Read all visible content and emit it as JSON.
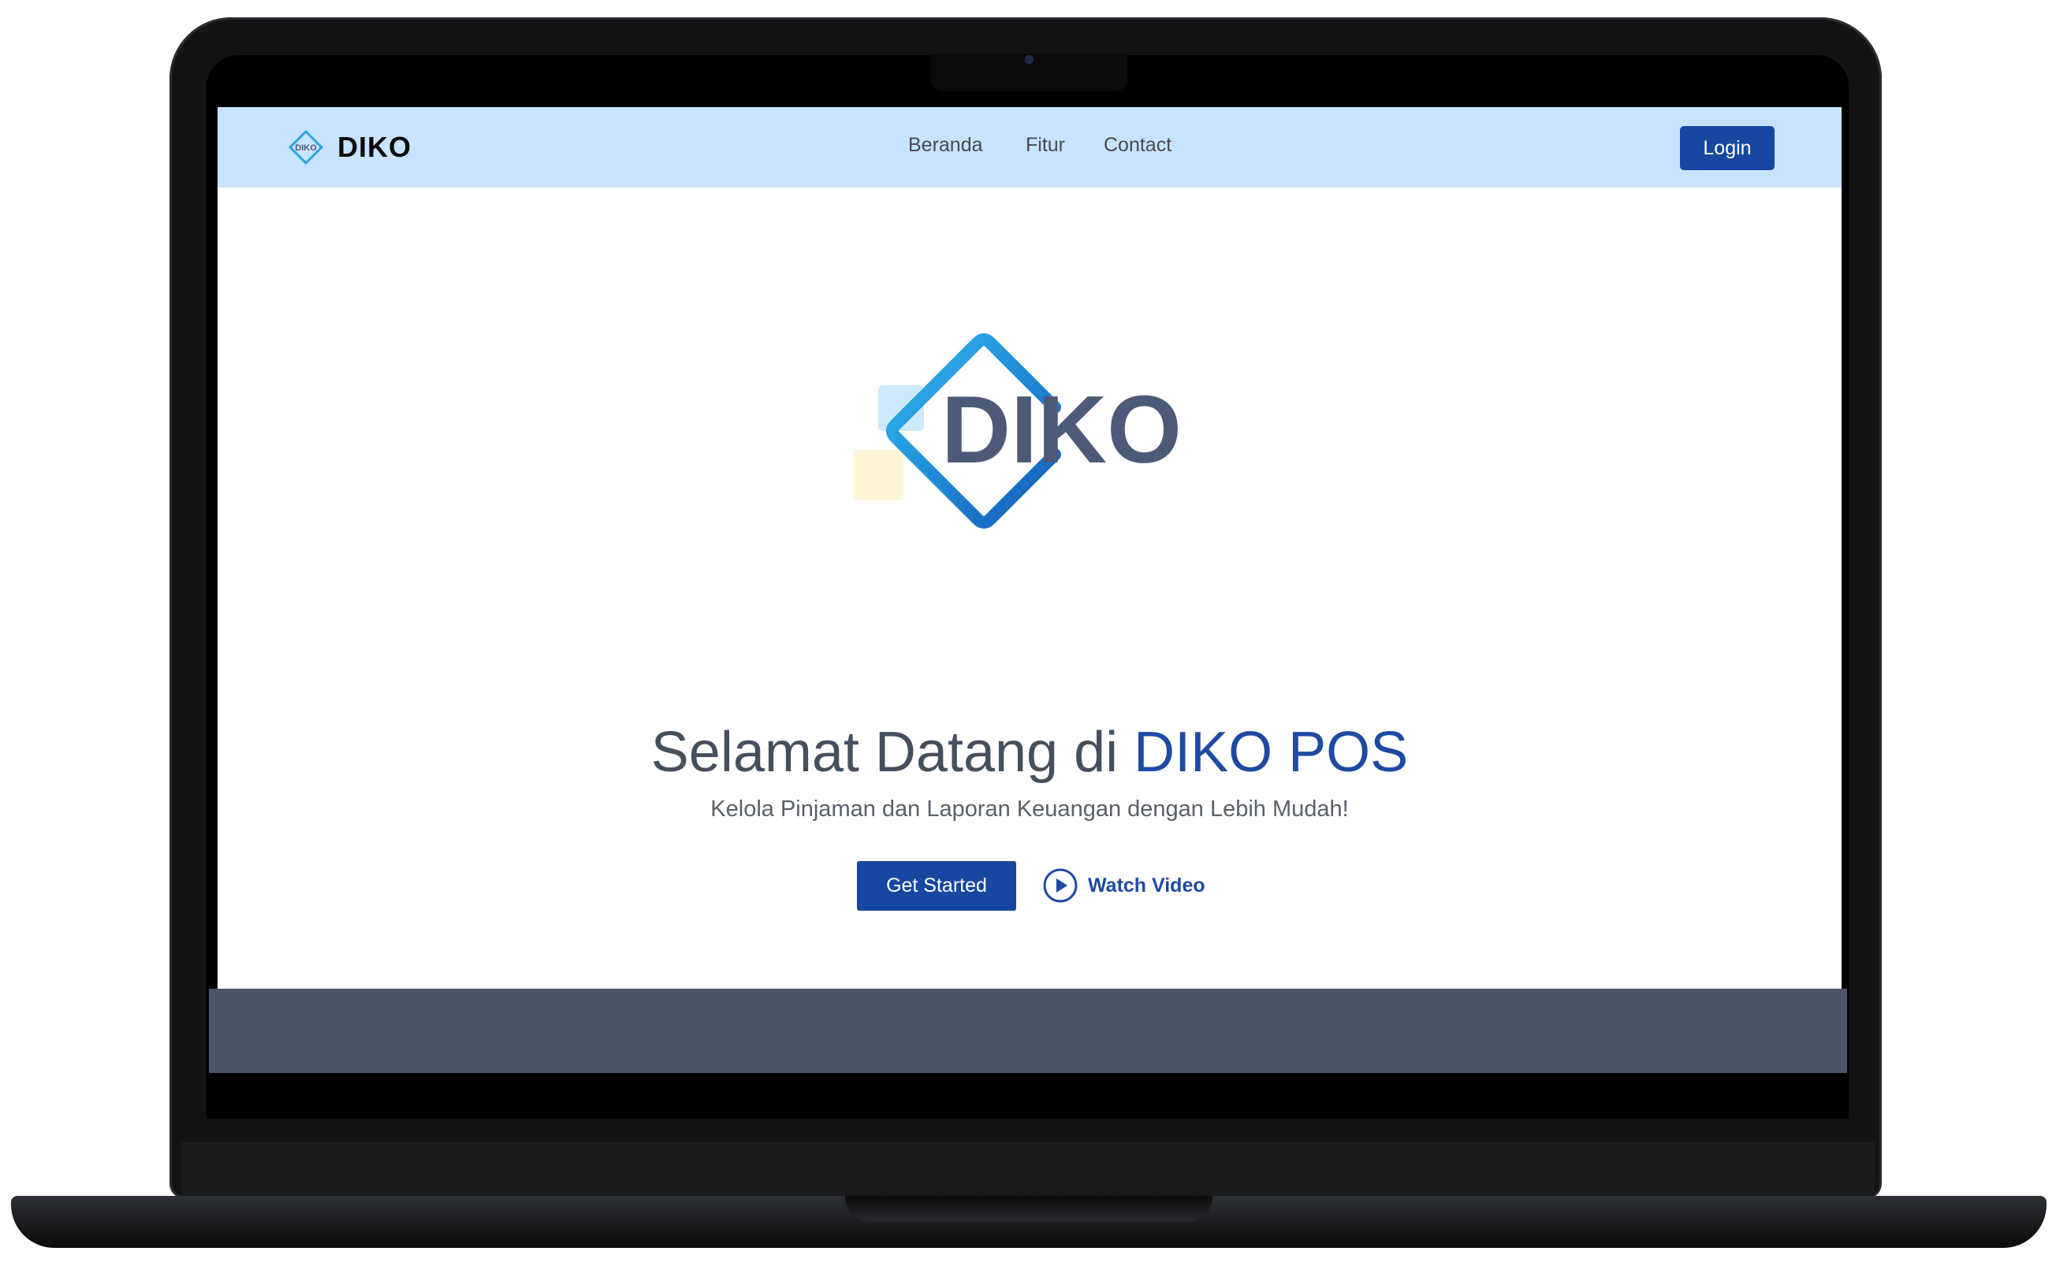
{
  "app": {
    "brand": "DIKO"
  },
  "nav": {
    "items": [
      "Beranda",
      "Fitur",
      "Contact"
    ],
    "login_label": "Login"
  },
  "hero": {
    "logo_text": "DIKO",
    "title_prefix": "Selamat Datang di ",
    "title_accent": "DIKO POS",
    "subtitle": "Kelola Pinjaman dan Laporan Keuangan dengan Lebih Mudah!",
    "cta_label": "Get Started",
    "watch_label": "Watch Video"
  },
  "colors": {
    "navbar_bg": "#c7e3ff",
    "primary": "#1747a0",
    "accent_text": "#1e4aa3",
    "logo_text": "#4d5a77",
    "band": "#4a5666"
  },
  "icons": {
    "brand": "diko-logo-icon",
    "play": "play-circle-icon"
  }
}
